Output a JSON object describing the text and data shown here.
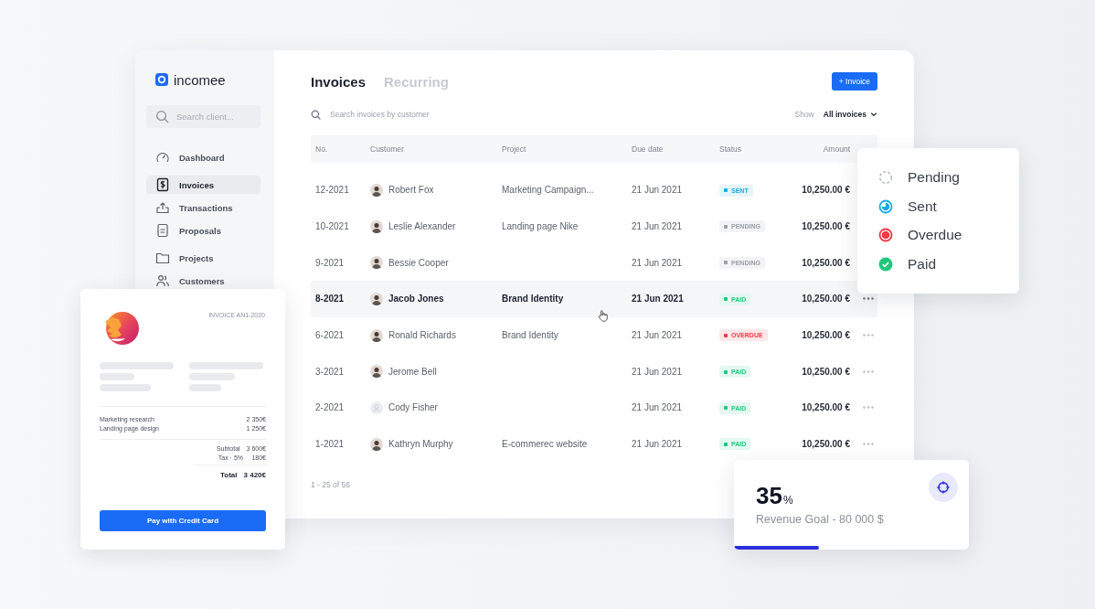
{
  "sidebar": {
    "logo": "incomee",
    "search": {
      "placeholder": "Search client..."
    },
    "items": [
      {
        "label": "Dashboard",
        "kind": "dashboard",
        "selected": false
      },
      {
        "label": "Invoices",
        "kind": "invoices",
        "selected": true
      },
      {
        "label": "Transactions",
        "kind": "transactions",
        "selected": false
      },
      {
        "label": "Proposals",
        "kind": "proposals",
        "selected": false
      },
      {
        "label": "Projects",
        "kind": "projects",
        "selected": false
      },
      {
        "label": "Customers",
        "kind": "customers",
        "selected": false
      }
    ]
  },
  "tabs": [
    {
      "label": "Invoices",
      "selected": true
    },
    {
      "label": "Recurring",
      "selected": false
    }
  ],
  "new_button": "+ Invoice",
  "search": {
    "placeholder": "Search invoices by customer"
  },
  "filter": {
    "label": "Show",
    "value": "All invoices"
  },
  "table": {
    "columns": [
      "No.",
      "Customer",
      "Project",
      "Due date",
      "Status",
      "Amount"
    ],
    "rows": [
      {
        "no": "12-2021",
        "customer": "Robert Fox",
        "avatar_placeholder": false,
        "project": "Marketing Campaign...",
        "due": "21 Jun 2021",
        "status_label": "SENT",
        "color": "#1aa9e6",
        "amount": "10,250.00 €",
        "selected": false,
        "more_menu": false
      },
      {
        "no": "10-2021",
        "customer": "Leslie Alexander",
        "avatar_placeholder": false,
        "project": "Landing page Nike",
        "due": "21 Jun 2021",
        "status_label": "PENDING",
        "color": "#9a9eab",
        "amount": "10,250.00 €",
        "selected": false,
        "more_menu": false
      },
      {
        "no": "9-2021",
        "customer": "Bessie Cooper",
        "avatar_placeholder": false,
        "due": "21 Jun 2021",
        "status_label": "PENDING",
        "color": "#9a9eab",
        "amount": "10,250.00 €",
        "selected": false,
        "more_menu": false
      },
      {
        "no": "8-2021",
        "customer": "Jacob Jones",
        "avatar_placeholder": false,
        "project": "Brand Identity",
        "due": "21 Jun 2021",
        "status_label": "PAID",
        "color": "#22c77f",
        "amount": "10,250.00 €",
        "selected": true,
        "more_menu": true
      },
      {
        "no": "6-2021",
        "customer": "Ronald Richards",
        "avatar_placeholder": false,
        "project": "Brand Identity",
        "due": "21 Jun 2021",
        "status_label": "OVERDUE",
        "color": "#ee3b45",
        "amount": "10,250.00 €",
        "selected": false,
        "more_menu": true
      },
      {
        "no": "3-2021",
        "customer": "Jerome Bell",
        "avatar_placeholder": false,
        "due": "21 Jun 2021",
        "status_label": "PAID",
        "color": "#22c77f",
        "amount": "10,250.00 €",
        "selected": false,
        "more_menu": true
      },
      {
        "no": "2-2021",
        "customer": "Cody Fisher",
        "avatar_placeholder": true,
        "due": "21 Jun 2021",
        "status_label": "PAID",
        "color": "#22c77f",
        "amount": "10,250.00 €",
        "selected": false,
        "more_menu": true
      },
      {
        "no": "1-2021",
        "customer": "Kathryn Murphy",
        "avatar_placeholder": false,
        "project": "E-commerec website",
        "due": "21 Jun 2021",
        "status_label": "PAID",
        "color": "#22c77f",
        "amount": "10,250.00 €",
        "selected": false,
        "more_menu": true
      }
    ]
  },
  "pagination": "1 - 25 of 56",
  "legend": [
    {
      "kind": "pending",
      "label": "Pending"
    },
    {
      "kind": "sent",
      "label": "Sent"
    },
    {
      "kind": "overdue",
      "label": "Overdue"
    },
    {
      "kind": "paid",
      "label": "Paid"
    }
  ],
  "invoice_card": {
    "number": "INVOICE AN1-2020",
    "lines": [
      {
        "item": "Marketing research",
        "amount": "2 350€"
      },
      {
        "item": "Landing page design",
        "amount": "1 250€"
      }
    ],
    "subtotal": {
      "label": "Subtotal",
      "amount": "3 600€"
    },
    "tax": {
      "label": "Tax · 5%",
      "amount": "180€"
    },
    "total": {
      "label": "Total",
      "amount": "3 420€"
    },
    "button": "Pay with Credit Card"
  },
  "goal_card": {
    "value": "35",
    "unit": "%",
    "label": "Revenue Goal - 80 000 $",
    "level": 0.36
  }
}
